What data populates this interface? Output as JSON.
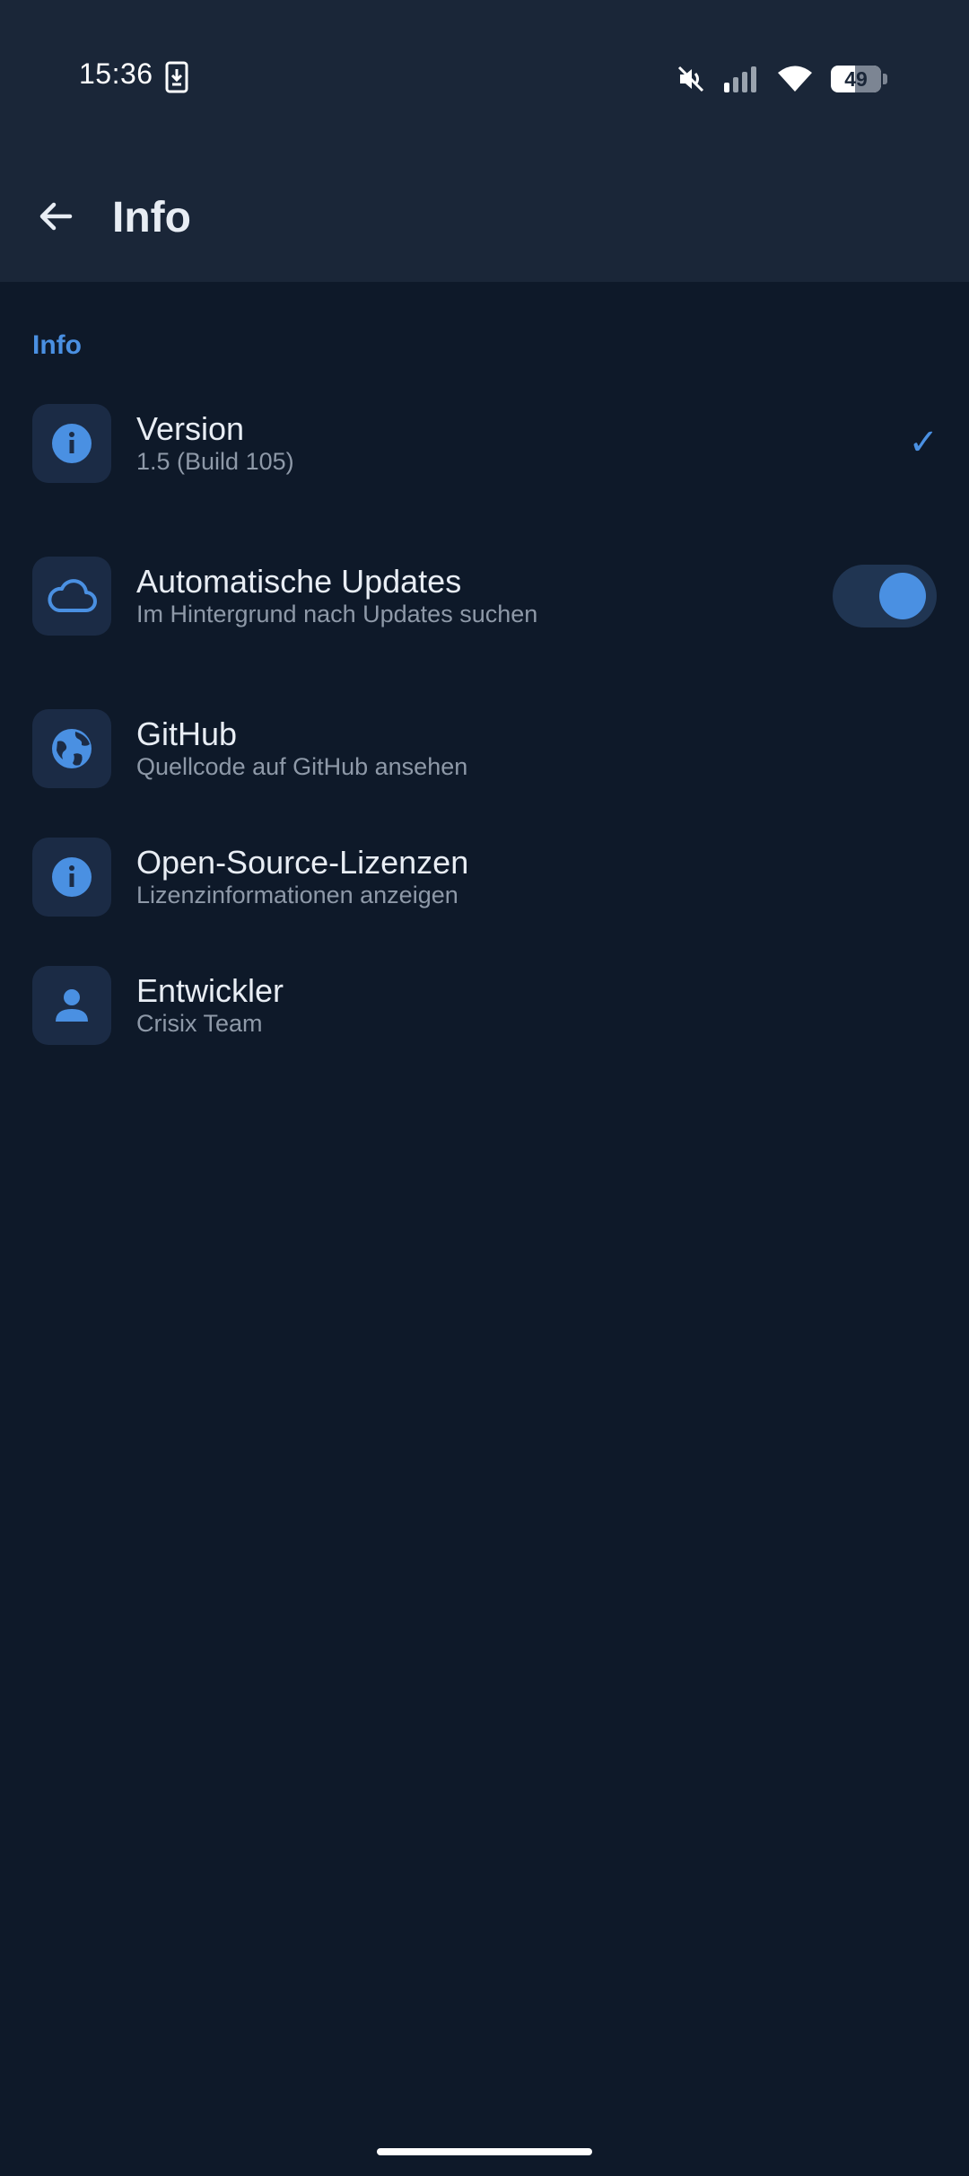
{
  "status_bar": {
    "time": "15:36",
    "battery_percent": "49",
    "battery_level": 0.49,
    "icons": [
      "download-notification-icon",
      "mute-icon",
      "signal-icon",
      "wifi-icon",
      "battery-icon"
    ]
  },
  "app_bar": {
    "back_icon": "arrow-back-icon",
    "title": "Info"
  },
  "section": {
    "title": "Info"
  },
  "items": [
    {
      "icon": "info-icon",
      "title": "Version",
      "subtitle": "1.5 (Build 105)",
      "trailing": "✓"
    },
    {
      "icon": "cloud-icon",
      "title": "Automatische Updates",
      "subtitle": "Im Hintergrund nach Updates suchen",
      "toggle_on": true
    },
    {
      "icon": "globe-icon",
      "title": "GitHub",
      "subtitle": "Quellcode auf GitHub ansehen"
    },
    {
      "icon": "info-icon",
      "title": "Open-Source-Lizenzen",
      "subtitle": "Lizenzinformationen anzeigen"
    },
    {
      "icon": "person-icon",
      "title": "Entwickler",
      "subtitle": "Crisix Team"
    }
  ],
  "colors": {
    "background": "#0e1929",
    "app_bar": "#1a2638",
    "accent": "#4a90e2",
    "icon_tile": "#1b2b45",
    "subtitle": "#8e99a8"
  }
}
